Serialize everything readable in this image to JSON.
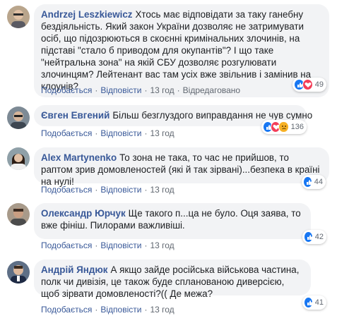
{
  "comments": [
    {
      "author": "Andrzej Leszkiewicz",
      "text": "Хтось має відповідати за таку ганебну бездіяльність. Який закон України дозволяє не затримувати осіб, що підозрюються в скоєнні кримінальних злочинів, на підставі \"стало б приводом для окупантів\"? І що таке \"нейтральна зона\" на якій СБУ дозволяє розгулювати злочинцям? Лейтенант вас там усіх вже звільнив і замінив на клоунів?",
      "like_label": "Подобається",
      "reply_label": "Відповісти",
      "time": "13 год",
      "edited_label": "Відредаговано",
      "reaction_count": "49",
      "reactions": [
        "like-icon",
        "love-icon"
      ]
    },
    {
      "author": "Євген Евгений",
      "text": "Більш безглуздого виправдання не чув сумно",
      "like_label": "Подобається",
      "reply_label": "Відповісти",
      "time": "13 год",
      "reaction_count": "136",
      "reactions": [
        "like-icon",
        "love-icon",
        "sad-icon"
      ]
    },
    {
      "author": "Alex Martynenko",
      "text": "То зона не така, то час не прийшов, то раптом зрив домовленостей (які й так зірвані)...безпека в країні на нулі!",
      "like_label": "Подобається",
      "reply_label": "Відповісти",
      "time": "13 год",
      "reaction_count": "44",
      "reactions": [
        "like-icon"
      ]
    },
    {
      "author": "Олександр Юрчук",
      "text": "Ще такого п...ца не було. Оця заява, то вже фініш. Пилорами важливіші.",
      "like_label": "Подобається",
      "reply_label": "Відповісти",
      "time": "13 год",
      "reaction_count": "42",
      "reactions": [
        "like-icon"
      ]
    },
    {
      "author": "Андрій Яндюк",
      "text": "А якщо зайде російська військова частина, полк чи дивізія, це також буде спланованою диверсією, щоб зірвати домовленості?(( Де межа?",
      "like_label": "Подобається",
      "reply_label": "Відповісти",
      "time": "13 год",
      "reaction_count": "41",
      "reactions": [
        "like-icon"
      ]
    }
  ]
}
